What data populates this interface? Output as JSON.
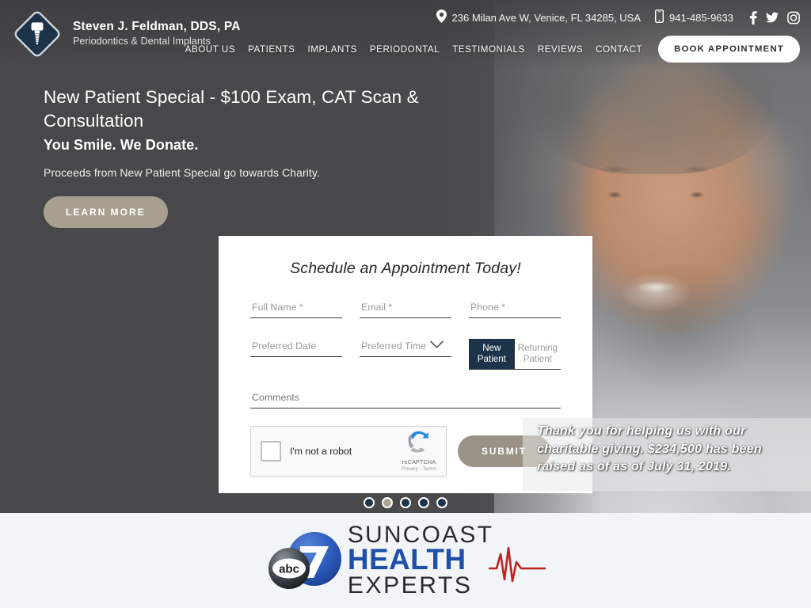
{
  "site": {
    "logo": {
      "name": "Steven J. Feldman, DDS, PA",
      "tagline": "Periodontics & Dental Implants",
      "icon": "dental-implant-icon"
    }
  },
  "topbar": {
    "address": "236 Milan Ave W, Venice, FL 34285, USA",
    "address_icon": "location-pin-icon",
    "phone": "941-485-9633",
    "phone_icon": "mobile-phone-icon",
    "social": [
      {
        "name": "facebook-icon",
        "label": "Facebook"
      },
      {
        "name": "twitter-icon",
        "label": "Twitter"
      },
      {
        "name": "instagram-icon",
        "label": "Instagram"
      }
    ]
  },
  "nav": {
    "items": [
      {
        "label": "ABOUT US"
      },
      {
        "label": "PATIENTS"
      },
      {
        "label": "IMPLANTS"
      },
      {
        "label": "PERIODONTAL"
      },
      {
        "label": "TESTIMONIALS"
      },
      {
        "label": "REVIEWS"
      },
      {
        "label": "CONTACT"
      }
    ],
    "cta_label": "BOOK APPOINTMENT"
  },
  "hero": {
    "heading": "New Patient Special - $100 Exam, CAT Scan & Consultation",
    "subheading": "You Smile. We Donate.",
    "paragraph": "Proceeds from New Patient Special go towards Charity.",
    "cta_label": "LEARN MORE",
    "slide_count": 5,
    "active_slide": 2
  },
  "form": {
    "title": "Schedule an Appointment Today!",
    "fields": {
      "full_name": {
        "placeholder": "Full Name *",
        "value": ""
      },
      "email": {
        "placeholder": "Email *",
        "value": ""
      },
      "phone": {
        "placeholder": "Phone *",
        "value": ""
      },
      "preferred_date": {
        "placeholder": "Preferred Date",
        "value": ""
      },
      "preferred_time": {
        "placeholder": "Preferred Time",
        "value": "",
        "icon": "chevron-down-icon"
      },
      "comments": {
        "placeholder": "Comments",
        "value": ""
      }
    },
    "patient_toggle": {
      "new_label": "New Patient",
      "returning_label": "Returning Patient",
      "selected": "New Patient"
    },
    "captcha": {
      "checkbox_label": "I'm not a robot",
      "brand": "reCAPTCHA",
      "legal": "Privacy - Terms",
      "icon": "recaptcha-icon",
      "checked": false
    },
    "submit_label": "SUBMIT"
  },
  "charity": {
    "line1": "Thank you for helping us with our",
    "line2_pre": "charitable giving. ",
    "amount": "$234,500",
    "line2_post": " has been",
    "line3": "raised as of as of July 31, 2019."
  },
  "footer_logo": {
    "network": "abc",
    "channel": "7",
    "line1": "SUNCOAST",
    "line2": "HEALTH",
    "line3": "EXPERTS",
    "accent_color": "#1f4fa8",
    "ekg_color": "#c0221f"
  },
  "colors": {
    "navy": "#1d3349",
    "tan": "#a99f91",
    "hero_bg": "#58585a",
    "band_bg": "#f1f5f8"
  }
}
